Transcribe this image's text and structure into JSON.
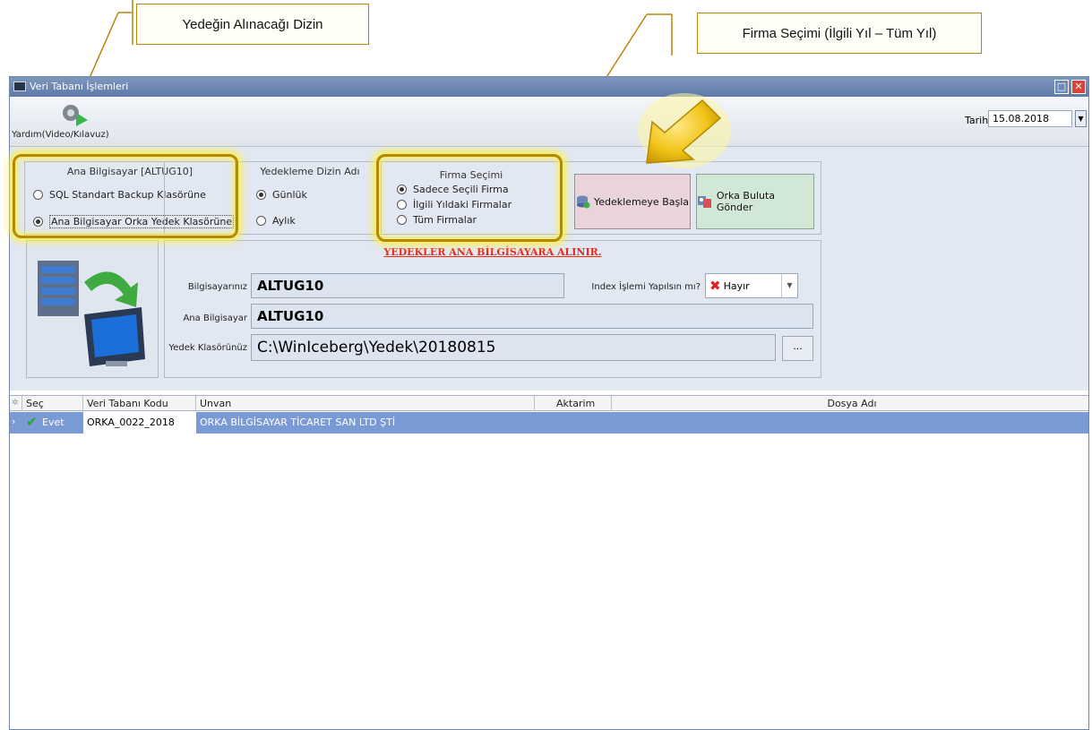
{
  "callouts": {
    "left": "Yedeğin Alınacağı Dizin",
    "right": "Firma Seçimi (İlgili Yıl – Tüm Yıl)"
  },
  "window": {
    "title": "Veri Tabanı İşlemleri",
    "controls": [
      "restore-icon",
      "close-icon"
    ]
  },
  "toolbar": {
    "help_label": "Yardım(Video/Kılavuz)",
    "help_icon": "video-help-icon",
    "date_label": "Tarih",
    "date_value": "15.08.2018"
  },
  "ana_bilgisayar": {
    "title": "Ana Bilgisayar [ALTUG10]",
    "options": [
      {
        "label": "SQL Standart Backup Klasörüne",
        "selected": false
      },
      {
        "label": "Ana Bilgisayar Orka Yedek Klasörüne",
        "selected": true
      }
    ]
  },
  "yedekleme_dizin": {
    "title": "Yedekleme Dizin Adı",
    "options": [
      {
        "label": "Günlük",
        "selected": true
      },
      {
        "label": "Aylık",
        "selected": false
      }
    ]
  },
  "firma_secimi": {
    "title": "Firma Seçimi",
    "options": [
      {
        "label": "Sadece Seçili Firma",
        "selected": true
      },
      {
        "label": "İlgili Yıldaki Firmalar",
        "selected": false
      },
      {
        "label": "Tüm Firmalar",
        "selected": false
      }
    ]
  },
  "buttons": {
    "backup": {
      "label": "Yedeklemeye Başla",
      "icon": "database-backup-icon"
    },
    "cloud": {
      "label": "Orka Buluta Gönder",
      "icon": "cloud-send-icon"
    }
  },
  "info": {
    "banner": "YEDEKLER ANA BİLGİSAYARA ALINIR.",
    "computer_label": "Bilgisayarınız",
    "computer_value": "ALTUG10",
    "host_label": "Ana Bilgisayar",
    "host_value": "ALTUG10",
    "folder_label": "Yedek Klasörünüz",
    "folder_value": "C:\\WinIceberg\\Yedek\\20180815",
    "browse_label": "...",
    "index_label": "Index İşlemi Yapılsın mı?",
    "index_value": "Hayır"
  },
  "grid": {
    "columns": [
      "Seç",
      "Veri Tabanı Kodu",
      "Unvan",
      "Aktarim",
      "Dosya Adı"
    ],
    "rows": [
      {
        "sec": "Evet",
        "kod": "ORKA_0022_2018",
        "unvan": "ORKA BİLGİSAYAR TİCARET SAN LTD ŞTİ",
        "aktarim": "",
        "dosya": ""
      }
    ]
  },
  "colors": {
    "accent_highlight": "#f2e44a",
    "banner_red": "#e8281c",
    "selected_row": "#7a9ad6"
  }
}
